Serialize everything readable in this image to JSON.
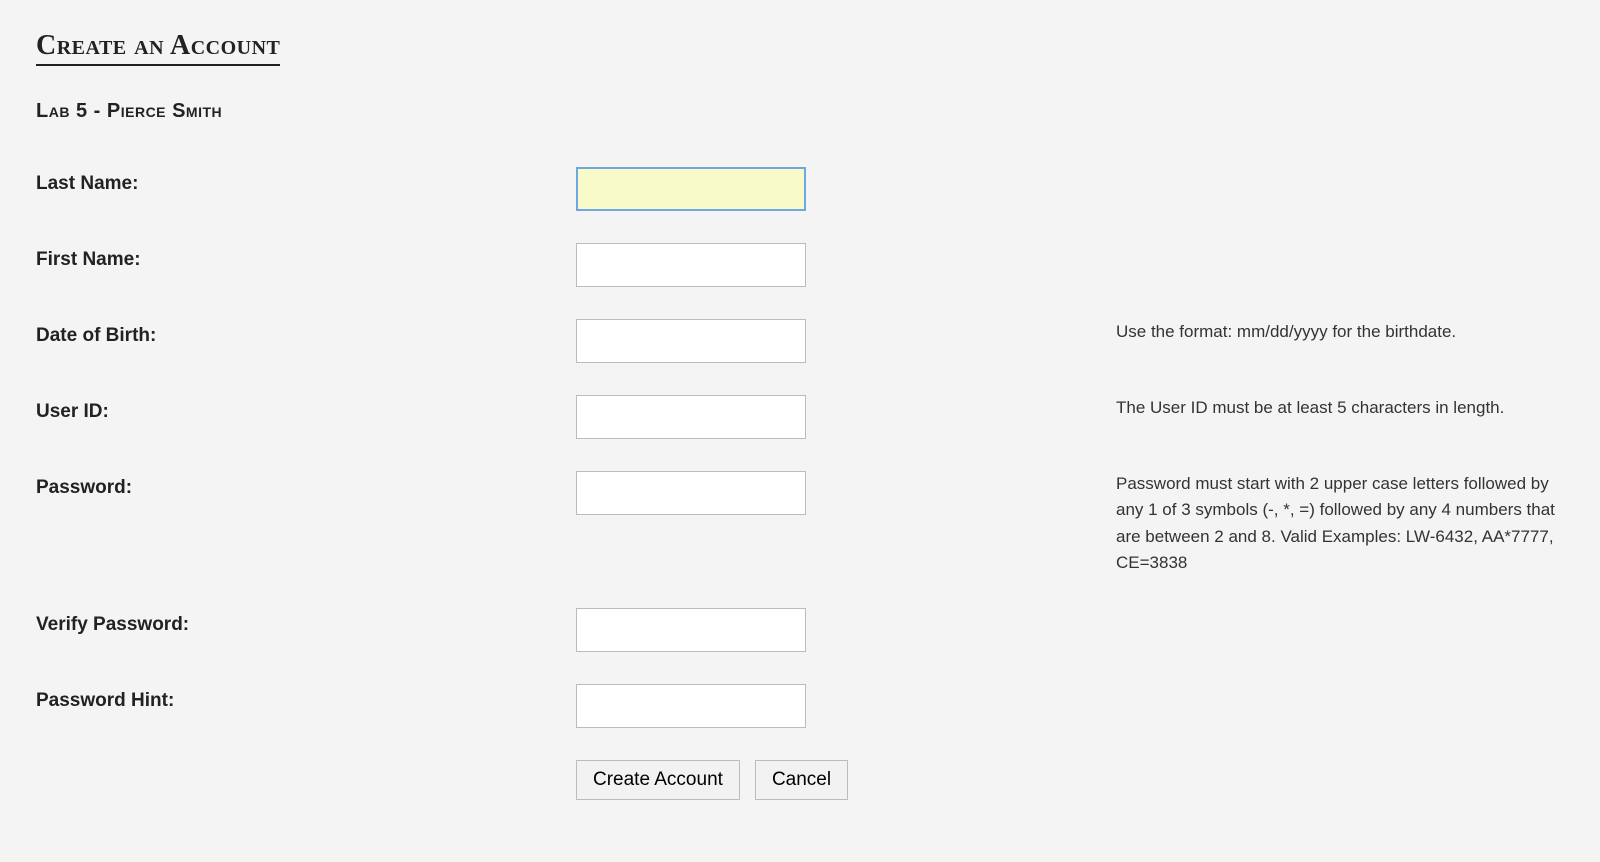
{
  "title": "Create an Account",
  "subtitle": "Lab 5 - Pierce Smith",
  "fields": {
    "last_name": {
      "label": "Last Name:",
      "hint": ""
    },
    "first_name": {
      "label": "First Name:",
      "hint": ""
    },
    "dob": {
      "label": "Date of Birth:",
      "hint": "Use the format: mm/dd/yyyy for the birthdate."
    },
    "user_id": {
      "label": "User ID:",
      "hint": "The User ID must be at least 5 characters in length."
    },
    "password": {
      "label": "Password:",
      "hint": "Password must start with 2 upper case letters followed by any 1 of 3 symbols (-, *, =) followed by any 4 numbers that are between 2 and 8. Valid Examples: LW-6432, AA*7777, CE=3838"
    },
    "verify_password": {
      "label": "Verify Password:",
      "hint": ""
    },
    "password_hint": {
      "label": "Password Hint:",
      "hint": ""
    }
  },
  "buttons": {
    "create": "Create Account",
    "cancel": "Cancel"
  }
}
